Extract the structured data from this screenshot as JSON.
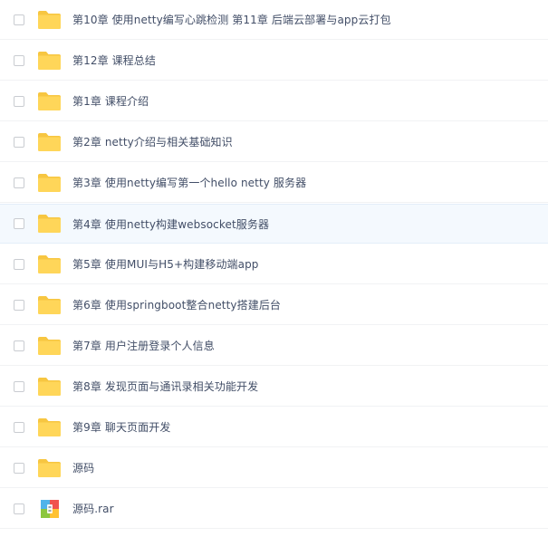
{
  "files": [
    {
      "name": "第10章 使用netty编写心跳检测 第11章 后端云部署与app云打包",
      "type": "folder",
      "icon": "folder-icon"
    },
    {
      "name": "第12章 课程总结",
      "type": "folder",
      "icon": "folder-icon"
    },
    {
      "name": "第1章 课程介绍",
      "type": "folder",
      "icon": "folder-icon"
    },
    {
      "name": "第2章 netty介绍与相关基础知识",
      "type": "folder",
      "icon": "folder-icon"
    },
    {
      "name": "第3章 使用netty编写第一个hello netty 服务器",
      "type": "folder",
      "icon": "folder-icon"
    },
    {
      "name": "第4章 使用netty构建websocket服务器",
      "type": "folder",
      "icon": "folder-icon",
      "hovered": true
    },
    {
      "name": "第5章 使用MUI与H5+构建移动端app",
      "type": "folder",
      "icon": "folder-icon"
    },
    {
      "name": "第6章 使用springboot整合netty搭建后台",
      "type": "folder",
      "icon": "folder-icon"
    },
    {
      "name": "第7章 用户注册登录个人信息",
      "type": "folder",
      "icon": "folder-icon"
    },
    {
      "name": "第8章 发现页面与通讯录相关功能开发",
      "type": "folder",
      "icon": "folder-icon"
    },
    {
      "name": "第9章 聊天页面开发",
      "type": "folder",
      "icon": "folder-icon"
    },
    {
      "name": "源码",
      "type": "folder",
      "icon": "folder-icon"
    },
    {
      "name": "源码.rar",
      "type": "archive",
      "icon": "archive-icon"
    }
  ],
  "colors": {
    "folder": "#ffd659",
    "folder_tab": "#f7c641",
    "text": "#424e67",
    "hover_bg": "#f4f9fe"
  }
}
